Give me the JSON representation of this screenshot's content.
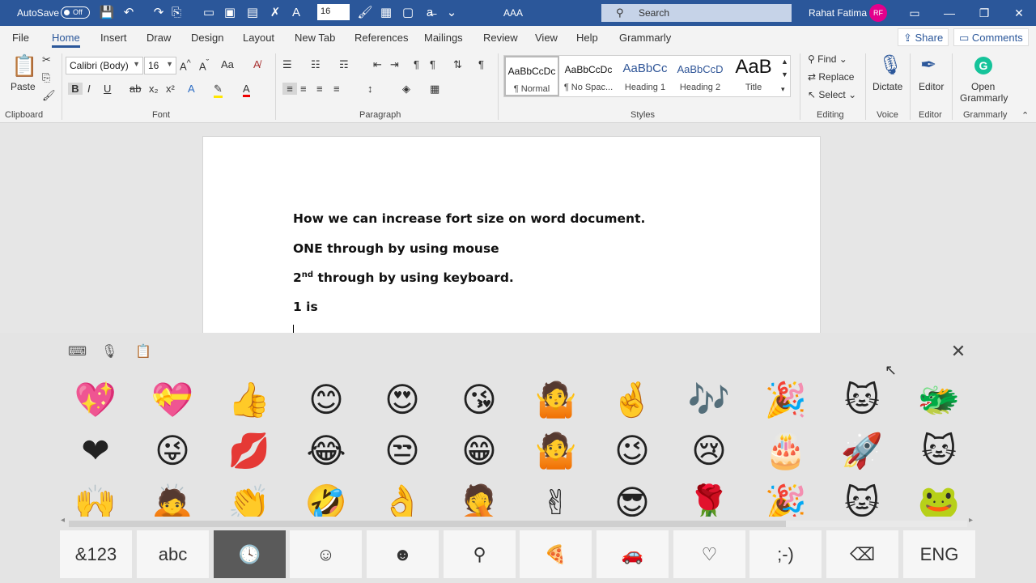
{
  "titlebar": {
    "autosave_label": "AutoSave",
    "autosave_state": "Off",
    "font_size_value": "16",
    "doc_name": "AAA",
    "search_placeholder": "Search",
    "user_name": "Rahat Fatima",
    "user_initials": "RF"
  },
  "menu": {
    "tabs": [
      "File",
      "Home",
      "Insert",
      "Draw",
      "Design",
      "Layout",
      "New Tab",
      "References",
      "Mailings",
      "Review",
      "View",
      "Help",
      "Grammarly"
    ],
    "share": "Share",
    "comments": "Comments"
  },
  "ribbon": {
    "clipboard": {
      "paste": "Paste",
      "label": "Clipboard"
    },
    "font": {
      "name": "Calibri (Body)",
      "size": "16",
      "label": "Font"
    },
    "paragraph": {
      "label": "Paragraph"
    },
    "styles": {
      "label": "Styles",
      "items": [
        {
          "sample": "AaBbCcDc",
          "name": "¶ Normal"
        },
        {
          "sample": "AaBbCcDc",
          "name": "¶ No Spac..."
        },
        {
          "sample": "AaBbCc",
          "name": "Heading 1"
        },
        {
          "sample": "AaBbCcD",
          "name": "Heading 2"
        },
        {
          "sample": "AaB",
          "name": "Title"
        }
      ]
    },
    "editing": {
      "find": "Find",
      "replace": "Replace",
      "select": "Select",
      "label": "Editing"
    },
    "voice": {
      "dictate": "Dictate",
      "label": "Voice"
    },
    "editor": {
      "button": "Editor",
      "label": "Editor"
    },
    "grammarly": {
      "button_line1": "Open",
      "button_line2": "Grammarly",
      "label": "Grammarly"
    }
  },
  "document": {
    "line1": "How we can increase fort size on word document.",
    "line2": "ONE through by using mouse",
    "line3_num": "2",
    "line3_sup": "nd",
    "line3_rest": " through by using keyboard.",
    "line4": "1 is"
  },
  "emoji_panel": {
    "rows": [
      [
        "💖",
        "💝",
        "👍",
        "😊",
        "😍",
        "😘",
        "🤷",
        "🤞",
        "🎶",
        "🎉",
        "🐱",
        "🐲"
      ],
      [
        "❤",
        "😜",
        "💋",
        "😂",
        "😒",
        "😁",
        "🤷",
        "😉",
        "😢",
        "🎂",
        "🚀",
        "🐱"
      ],
      [
        "🙌",
        "🙇",
        "👏",
        "🤣",
        "👌",
        "🤦",
        "✌",
        "😎",
        "🌹",
        "🎉",
        "🐱",
        "🐸"
      ]
    ],
    "keys": [
      "&123",
      "abc",
      "🕓",
      "☺",
      "☻",
      "⚲",
      "🍕",
      "🚗",
      "♡",
      ";-)",
      "⌫",
      "ENG"
    ]
  }
}
